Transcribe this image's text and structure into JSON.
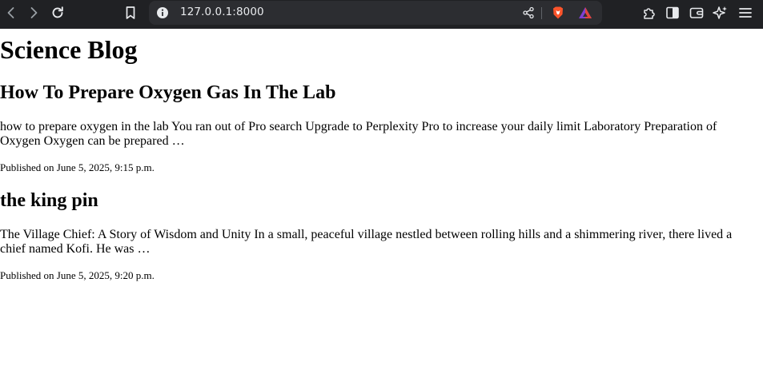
{
  "browser": {
    "url": "127.0.0.1:8000",
    "icons": {
      "back": "back-arrow-icon",
      "forward": "forward-arrow-icon",
      "reload": "reload-icon",
      "bookmark": "bookmark-icon",
      "site_info": "info-icon",
      "share": "share-icon",
      "shields": "brave-shields-icon",
      "rewards": "brave-rewards-icon",
      "extensions": "puzzle-icon",
      "sidebar": "sidebar-icon",
      "wallet": "wallet-icon",
      "leo": "sparkle-icon",
      "menu": "hamburger-menu-icon"
    },
    "colors": {
      "toolbar_bg": "#202124",
      "omnibox_bg": "#2c2d31",
      "icon": "#e8eaed",
      "brave_orange": "#fb542b"
    }
  },
  "page": {
    "site_title": "Science Blog",
    "posts": [
      {
        "title": "How To Prepare Oxygen Gas In The Lab",
        "excerpt": "how to prepare oxygen in the lab You ran out of Pro search Upgrade to Perplexity Pro to increase your daily limit Laboratory Preparation of Oxygen Oxygen can be prepared …",
        "published": "Published on June 5, 2025, 9:15 p.m."
      },
      {
        "title": "the king pin",
        "excerpt": "The Village Chief: A Story of Wisdom and Unity In a small, peaceful village nestled between rolling hills and a shimmering river, there lived a chief named Kofi. He was …",
        "published": "Published on June 5, 2025, 9:20 p.m."
      }
    ]
  }
}
